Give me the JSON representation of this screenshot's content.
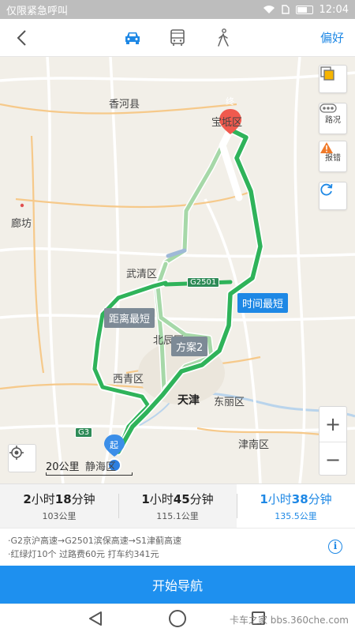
{
  "status_bar": {
    "carrier_text": "仅限紧急呼叫",
    "time": "12:04"
  },
  "top_nav": {
    "back_icon": "chevron-left-icon",
    "modes": [
      {
        "name": "car",
        "icon": "car-icon",
        "active": true
      },
      {
        "name": "bus",
        "icon": "bus-icon",
        "active": false
      },
      {
        "name": "walk",
        "icon": "walk-icon",
        "active": false
      }
    ],
    "preference_label": "偏好"
  },
  "map": {
    "places": {
      "xianghe": "香河县",
      "baodi": "宝坻区",
      "langfang": "廊坊",
      "wuqing": "武清区",
      "beichen": "北辰区",
      "xiqing": "西青区",
      "tianjin": "天津",
      "dongli": "东丽区",
      "jinnan": "津南区",
      "jinghai": "静海区"
    },
    "start_marker": "起",
    "end_marker": "终",
    "route_labels": {
      "distance": "距离最短",
      "plan2": "方案2",
      "time": "时间最短"
    },
    "highway_badges": {
      "g2501": "G2501",
      "g3": "G3"
    },
    "side_buttons": {
      "traffic": "路况",
      "report": "报错"
    },
    "scale_text": "20公里",
    "zoom_in": "+",
    "zoom_out": "−"
  },
  "routes": [
    {
      "time_h": "2",
      "time_h_unit": "小时",
      "time_m": "18",
      "time_m_unit": "分钟",
      "distance": "103公里",
      "active": false
    },
    {
      "time_h": "1",
      "time_h_unit": "小时",
      "time_m": "45",
      "time_m_unit": "分钟",
      "distance": "115.1公里",
      "active": false
    },
    {
      "time_h": "1",
      "time_h_unit": "小时",
      "time_m": "38",
      "time_m_unit": "分钟",
      "distance": "135.5公里",
      "active": true
    }
  ],
  "route_detail": {
    "roads": "·G2京沪高速→G2501滨保高速→S1津蓟高速",
    "summary": "·红绿灯10个  过路费60元  打车约341元"
  },
  "start_navigation_label": "开始导航",
  "watermark": "卡车之家  bbs.360che.com",
  "colors": {
    "accent": "#1e88e5",
    "route_main": "#2fb35a",
    "route_alt": "#a6d8a8"
  }
}
